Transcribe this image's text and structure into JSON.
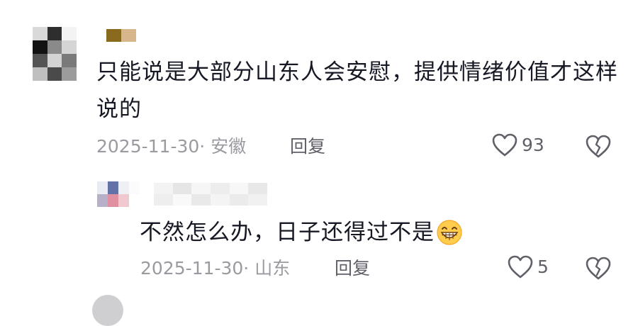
{
  "comment": {
    "text": "只能说是大部分山东人会安慰，提供情绪价值才这样说的",
    "date": "2025-11-30",
    "location_sep": "· 安徽",
    "reply_label": "回复",
    "likes": "93"
  },
  "reply": {
    "text": "不然怎么办，日子还得过不是",
    "date": "2025-11-30",
    "location_sep": "· 山东",
    "reply_label": "回复",
    "likes": "5"
  },
  "colors": {
    "text": "#161823",
    "meta": "#9a9ba1",
    "icon": "#5f6068"
  },
  "icons": [
    "heart-outline-icon",
    "broken-heart-icon",
    "grin-emoji-icon"
  ]
}
